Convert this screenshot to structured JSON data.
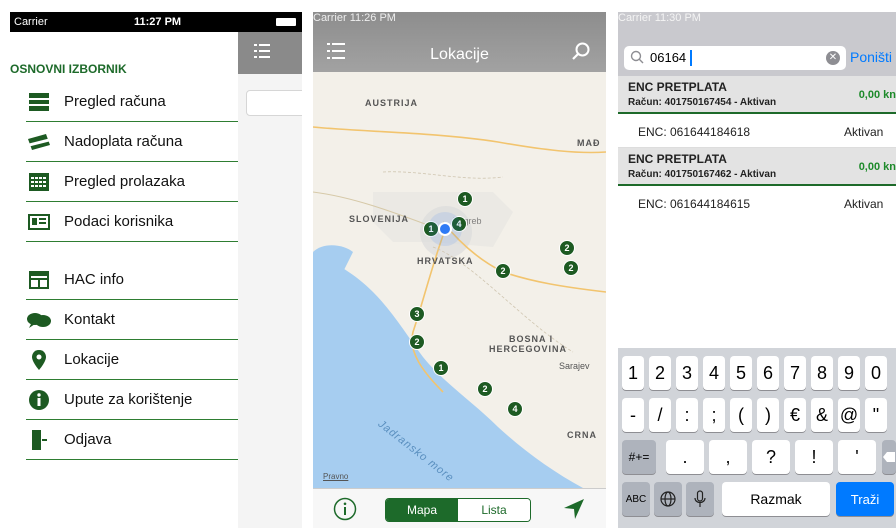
{
  "screen1": {
    "status": {
      "carrier": "Carrier",
      "time": "11:27 PM"
    },
    "menu_title": "OSNOVNI IZBORNIK",
    "items": [
      {
        "label": "Pregled računa",
        "icon": "bill-icon"
      },
      {
        "label": "Nadoplata računa",
        "icon": "card-icon"
      },
      {
        "label": "Pregled prolazaka",
        "icon": "calendar-icon"
      },
      {
        "label": "Podaci korisnika",
        "icon": "id-card-icon"
      },
      {
        "label": "HAC info",
        "icon": "info-board-icon"
      },
      {
        "label": "Kontakt",
        "icon": "chat-icon"
      },
      {
        "label": "Lokacije",
        "icon": "location-pin-icon"
      },
      {
        "label": "Upute za korištenje",
        "icon": "info-circle-icon"
      },
      {
        "label": "Odjava",
        "icon": "logout-door-icon"
      }
    ]
  },
  "screen2": {
    "status": {
      "carrier": "Carrier",
      "time": "11:26 PM"
    },
    "title": "Lokacije",
    "map": {
      "labels": [
        "AUSTRIJA",
        "MAĐ",
        "SLOVENIJA",
        "HRVATSKA",
        "BOSNA I",
        "HERCEGOVINA",
        "Sarajev",
        "CRNA",
        "Zagreb",
        "Pravno"
      ],
      "sea_label": "Jadransko more",
      "pins": [
        "1",
        "1",
        "4",
        "2",
        "2",
        "2",
        "3",
        "2",
        "1",
        "2",
        "4"
      ]
    },
    "segments": {
      "selected": "Mapa",
      "other": "Lista"
    }
  },
  "screen3": {
    "status": {
      "carrier": "Carrier",
      "time": "11:30 PM"
    },
    "search_value": "06164",
    "cancel_label": "Poništi",
    "results": [
      {
        "title": "ENC PRETPLATA",
        "account": "Račun: 401750167454 - Aktivan",
        "amount": "0,00 kn",
        "enc": "ENC: 061644184618",
        "status": "Aktivan"
      },
      {
        "title": "ENC PRETPLATA",
        "account": "Račun: 401750167462 - Aktivan",
        "amount": "0,00 kn",
        "enc": "ENC: 061644184615",
        "status": "Aktivan"
      }
    ],
    "keyboard": {
      "row1": [
        "1",
        "2",
        "3",
        "4",
        "5",
        "6",
        "7",
        "8",
        "9",
        "0"
      ],
      "row2": [
        "-",
        "/",
        ":",
        ";",
        "(",
        ")",
        "€",
        "&",
        "@",
        "\""
      ],
      "row3": [
        ".",
        ",",
        "?",
        "!",
        "'"
      ],
      "mode_key": "#+=",
      "abc_key": "ABC",
      "space_label": "Razmak",
      "search_label": "Traži"
    }
  },
  "colors": {
    "brand_green": "#1d6a2a",
    "ios_blue": "#007aff"
  }
}
